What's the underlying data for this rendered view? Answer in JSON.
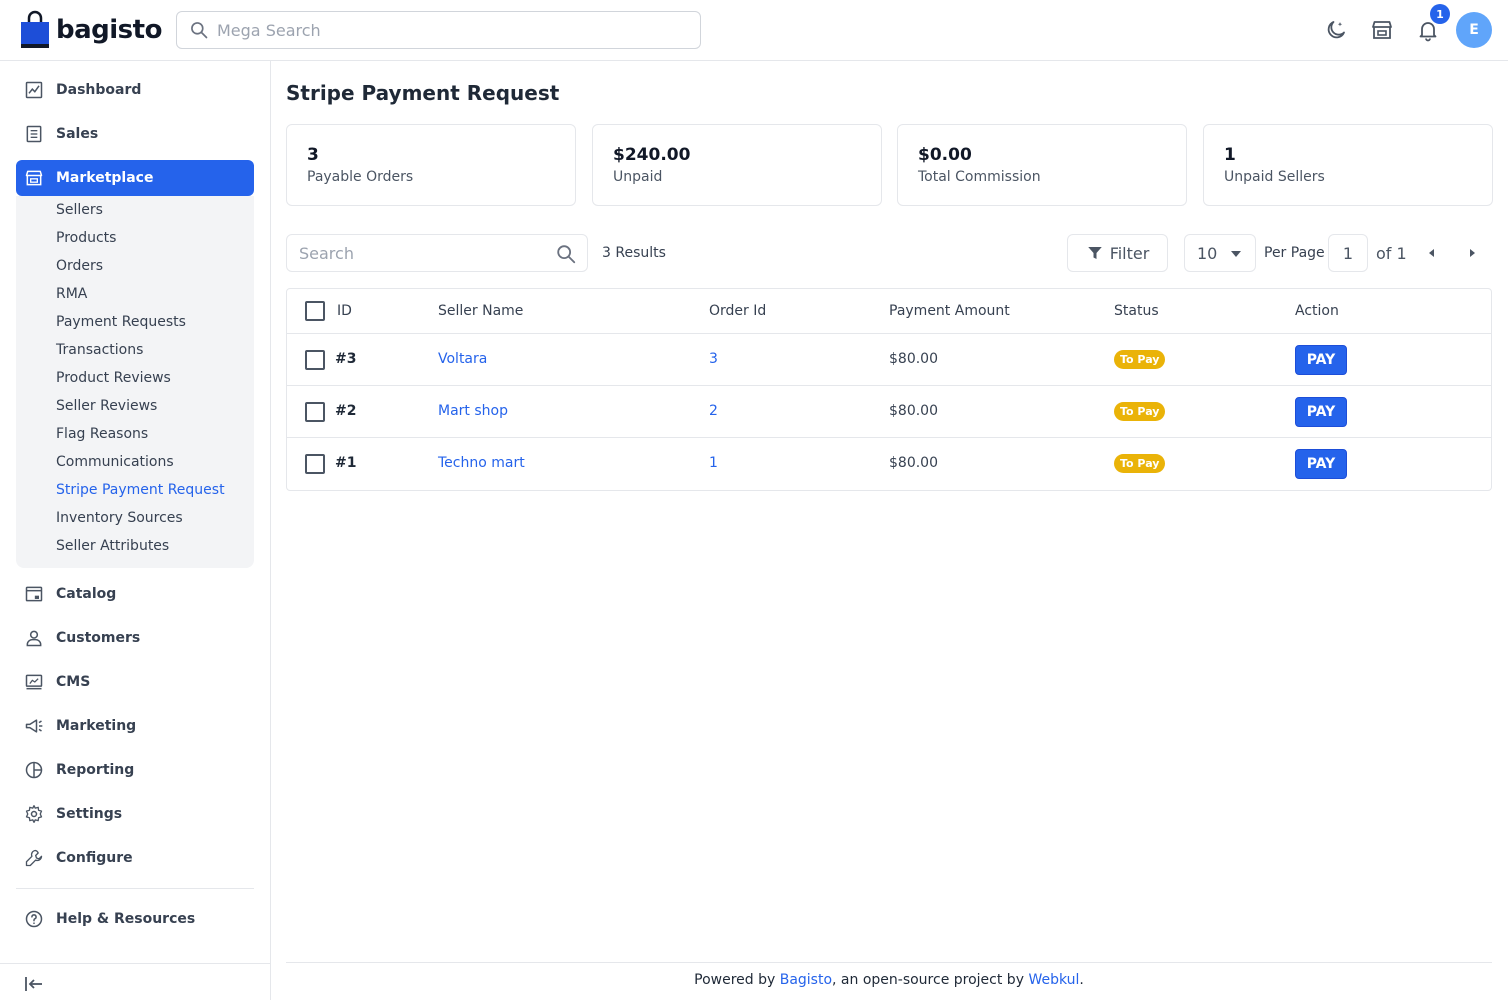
{
  "brand": {
    "name": "bagisto"
  },
  "header": {
    "search_placeholder": "Mega Search",
    "notification_count": "1",
    "avatar_initial": "E"
  },
  "sidebar": {
    "items": [
      {
        "label": "Dashboard",
        "icon": "dashboard-icon"
      },
      {
        "label": "Sales",
        "icon": "sales-icon"
      },
      {
        "label": "Marketplace",
        "icon": "store-icon"
      },
      {
        "label": "Catalog",
        "icon": "catalog-icon"
      },
      {
        "label": "Customers",
        "icon": "customers-icon"
      },
      {
        "label": "CMS",
        "icon": "cms-icon"
      },
      {
        "label": "Marketing",
        "icon": "megaphone-icon"
      },
      {
        "label": "Reporting",
        "icon": "pie-chart-icon"
      },
      {
        "label": "Settings",
        "icon": "gear-icon"
      },
      {
        "label": "Configure",
        "icon": "wrench-icon"
      },
      {
        "label": "Help & Resources",
        "icon": "help-icon"
      }
    ],
    "submenu": [
      "Sellers",
      "Products",
      "Orders",
      "RMA",
      "Payment Requests",
      "Transactions",
      "Product Reviews",
      "Seller Reviews",
      "Flag Reasons",
      "Communications",
      "Stripe Payment Request",
      "Inventory Sources",
      "Seller Attributes"
    ],
    "active_item": "Marketplace",
    "active_subitem": "Stripe Payment Request"
  },
  "page": {
    "title": "Stripe Payment Request",
    "cards": [
      {
        "value": "3",
        "caption": "Payable Orders"
      },
      {
        "value": "$240.00",
        "caption": "Unpaid"
      },
      {
        "value": "$0.00",
        "caption": "Total Commission"
      },
      {
        "value": "1",
        "caption": "Unpaid Sellers"
      }
    ]
  },
  "toolbar": {
    "search_placeholder": "Search",
    "results": "3 Results",
    "filter_label": "Filter",
    "per_page_value": "10",
    "per_page_label": "Per Page",
    "current_page": "1",
    "of_label": "of 1"
  },
  "table": {
    "headers": [
      "ID",
      "Seller Name",
      "Order Id",
      "Payment Amount",
      "Status",
      "Action"
    ],
    "rows": [
      {
        "id": "#3",
        "seller": "Voltara",
        "order_id": "3",
        "amount": "$80.00",
        "status": "To Pay",
        "action": "PAY"
      },
      {
        "id": "#2",
        "seller": "Mart shop",
        "order_id": "2",
        "amount": "$80.00",
        "status": "To Pay",
        "action": "PAY"
      },
      {
        "id": "#1",
        "seller": "Techno mart",
        "order_id": "1",
        "amount": "$80.00",
        "status": "To Pay",
        "action": "PAY"
      }
    ]
  },
  "footer": {
    "prefix": "Powered by ",
    "link1": "Bagisto",
    "middle": ", an open-source project by ",
    "link2": "Webkul",
    "suffix": "."
  },
  "colors": {
    "accent": "#2563eb",
    "badge": "#eab308",
    "border": "#e5e7eb"
  }
}
